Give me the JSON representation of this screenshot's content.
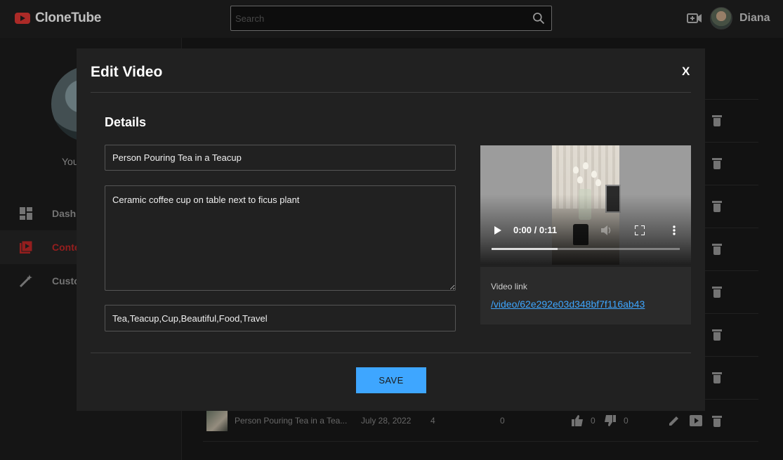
{
  "app": {
    "name": "CloneTube",
    "brand_color": "#e53935",
    "accent_color": "#3ea6ff"
  },
  "header": {
    "search_placeholder": "Search",
    "user_name": "Diana"
  },
  "sidebar": {
    "channel_label": "You",
    "items": [
      {
        "label": "Dashb",
        "icon": "dashboard-icon",
        "active": false
      },
      {
        "label": "Conte",
        "icon": "content-icon",
        "active": true
      },
      {
        "label": "Custo",
        "icon": "customization-icon",
        "active": false
      }
    ]
  },
  "content": {
    "last_row": {
      "title": "Person Pouring Tea in a Tea...",
      "date": "July 28, 2022",
      "views": "4",
      "comments": "0",
      "likes": "0",
      "dislikes": "0"
    }
  },
  "modal": {
    "title": "Edit Video",
    "close_label": "X",
    "section_title": "Details",
    "video_title": "Person Pouring Tea in a Teacup",
    "description": "Ceramic coffee cup on table next to ficus plant",
    "tags": "Tea,Teacup,Cup,Beautiful,Food,Travel",
    "player": {
      "time": "0:00 / 0:11",
      "progress": 0.35
    },
    "video_link_label": "Video link",
    "video_link": "/video/62e292e03d348bf7f116ab43",
    "save_label": "SAVE"
  }
}
